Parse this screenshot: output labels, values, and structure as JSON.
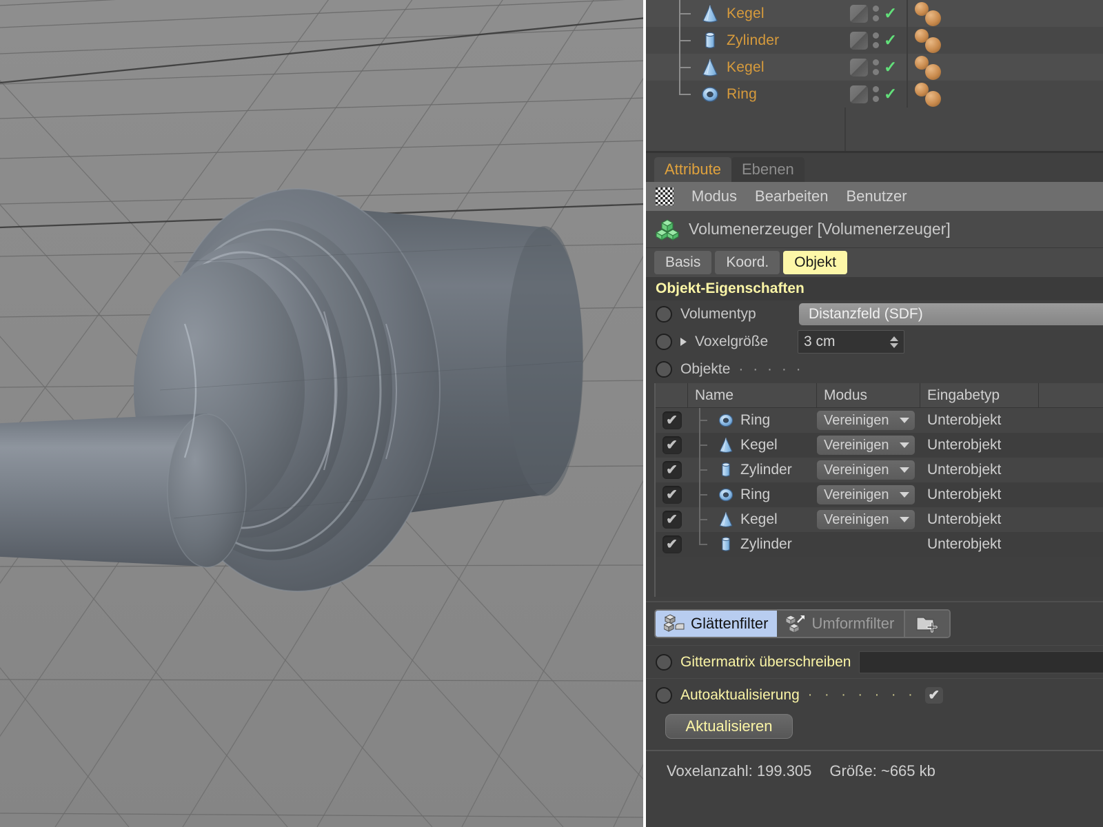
{
  "object_manager": {
    "items": [
      {
        "name": "Kegel",
        "icon": "cone-icon",
        "visible_check": "✓",
        "last": false
      },
      {
        "name": "Zylinder",
        "icon": "cylinder-icon",
        "visible_check": "✓",
        "last": false
      },
      {
        "name": "Kegel",
        "icon": "cone-icon",
        "visible_check": "✓",
        "last": false
      },
      {
        "name": "Ring",
        "icon": "torus-icon",
        "visible_check": "✓",
        "last": true
      }
    ]
  },
  "tabs": {
    "attribute": "Attribute",
    "ebenen": "Ebenen"
  },
  "menu": {
    "modus": "Modus",
    "bearbeiten": "Bearbeiten",
    "benutzer": "Benutzer"
  },
  "object_header": {
    "title": "Volumenerzeuger [Volumenerzeuger]",
    "icon": "green-cubes-icon"
  },
  "subtabs": [
    {
      "label": "Basis",
      "active": false
    },
    {
      "label": "Koord.",
      "active": false
    },
    {
      "label": "Objekt",
      "active": true
    }
  ],
  "section": {
    "title": "Objekt-Eigenschaften"
  },
  "properties": {
    "volumentyp": {
      "label": "Volumentyp",
      "value": "Distanzfeld (SDF)"
    },
    "voxelgroesse": {
      "label": "Voxelgröße",
      "value": "3 cm"
    },
    "objekte": {
      "label": "Objekte",
      "dots": "· · · · ·"
    }
  },
  "objects_table": {
    "columns": [
      "",
      "Name",
      "Modus",
      "Eingabetyp",
      ""
    ],
    "rows": [
      {
        "checked": "✔",
        "icon": "torus-icon",
        "name": "Ring",
        "mode": "Vereinigen",
        "has_mode": true,
        "type": "Unterobjekt",
        "last": false
      },
      {
        "checked": "✔",
        "icon": "cone-icon",
        "name": "Kegel",
        "mode": "Vereinigen",
        "has_mode": true,
        "type": "Unterobjekt",
        "last": false
      },
      {
        "checked": "✔",
        "icon": "cylinder-icon",
        "name": "Zylinder",
        "mode": "Vereinigen",
        "has_mode": true,
        "type": "Unterobjekt",
        "last": false
      },
      {
        "checked": "✔",
        "icon": "torus-icon",
        "name": "Ring",
        "mode": "Vereinigen",
        "has_mode": true,
        "type": "Unterobjekt",
        "last": false
      },
      {
        "checked": "✔",
        "icon": "cone-icon",
        "name": "Kegel",
        "mode": "Vereinigen",
        "has_mode": true,
        "type": "Unterobjekt",
        "last": false
      },
      {
        "checked": "✔",
        "icon": "cylinder-icon",
        "name": "Zylinder",
        "mode": "",
        "has_mode": false,
        "type": "Unterobjekt",
        "last": true
      }
    ]
  },
  "filters": {
    "smooth": {
      "label": "Glättenfilter",
      "selected": true
    },
    "reshape": {
      "label": "Umformfilter",
      "selected": false
    },
    "add": {
      "label": "",
      "icon": "add-folder-icon"
    }
  },
  "bottom": {
    "gittermatrix": {
      "label": "Gittermatrix überschreiben",
      "value": ""
    },
    "autoupdate": {
      "label": "Autoaktualisierung",
      "dots": "· · · · · · ·",
      "checked": "✔"
    },
    "update_button": "Aktualisieren"
  },
  "status": {
    "voxel_count": "Voxelanzahl: 199.305",
    "size": "Größe: ~665 kb"
  },
  "colors": {
    "panel_bg": "#404040",
    "accent_orange": "#d79b3c",
    "accent_yellow": "#fbf5a6",
    "highlight_blue": "#b8cdf0",
    "check_green": "#62e07a",
    "viewport_gray": "#8a8a8a"
  }
}
